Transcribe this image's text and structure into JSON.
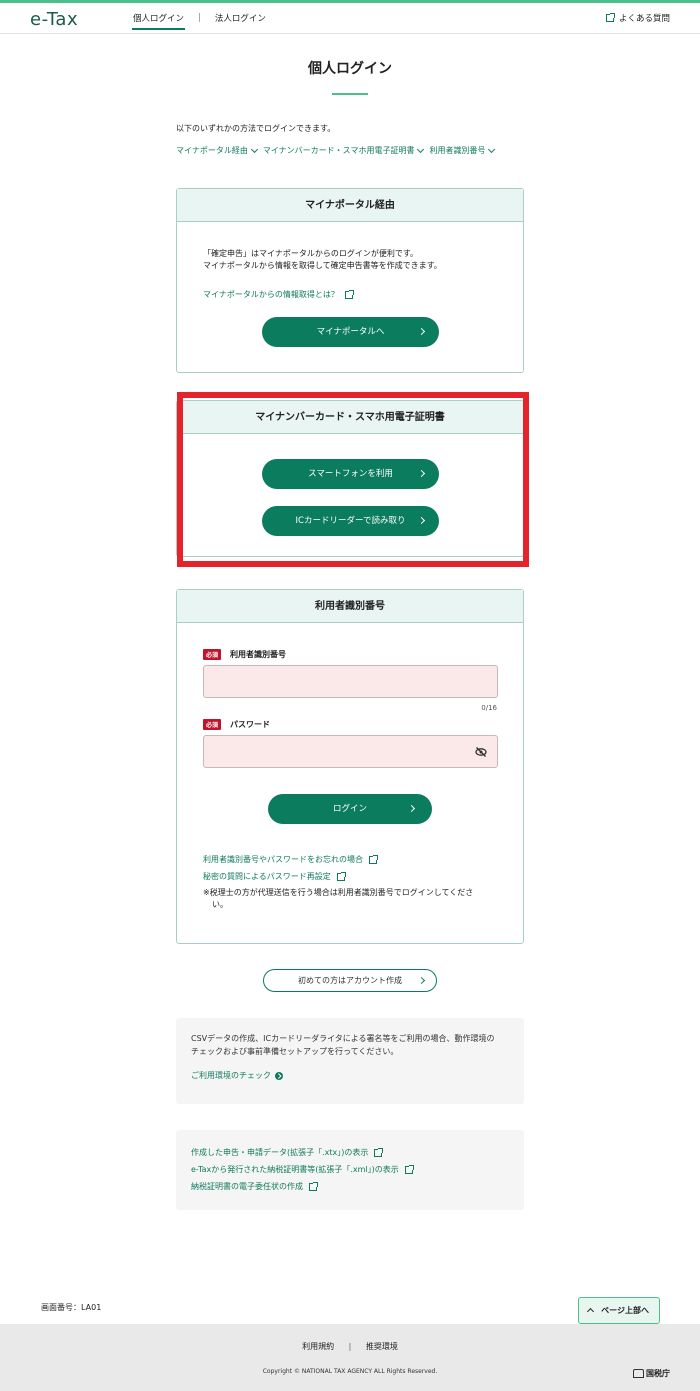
{
  "header": {
    "logo": "e-Tax",
    "tabs": [
      {
        "label": "個人ログイン"
      },
      {
        "label": "法人ログイン"
      }
    ],
    "separator": "|",
    "faq_label": "よくある質問"
  },
  "page": {
    "title": "個人ログイン",
    "intro": "以下のいずれかの方法でログインできます。",
    "anchors": [
      "マイナポータル経由",
      "マイナンバーカード・スマホ用電子証明書",
      "利用者識別番号"
    ]
  },
  "myna_portal": {
    "heading": "マイナポータル経由",
    "text1": "「確定申告」はマイナポータルからのログインが便利です。",
    "text2": "マイナポータルから情報を取得して確定申告書等を作成できます。",
    "link": "マイナポータルからの情報取得とは？",
    "button": "マイナポータルへ"
  },
  "mynumber_card": {
    "heading": "マイナンバーカード・スマホ用電子証明書",
    "button_smartphone": "スマートフォンを利用",
    "button_ic_reader": "ICカードリーダーで読み取り"
  },
  "user_id": {
    "heading": "利用者識別番号",
    "required_badge": "必須",
    "id_label": "利用者識別番号",
    "id_value": "",
    "id_count": "0/16",
    "password_label": "パスワード",
    "password_value": "",
    "login_button": "ログイン",
    "link_forgot": "利用者識別番号やパスワードをお忘れの場合",
    "link_reset": "秘密の質問によるパスワード再設定",
    "note_line1": "※税理士の方が代理送信を行う場合は利用者識別番号でログインしてくださ",
    "note_line2": "い。"
  },
  "create_account": "初めての方はアカウント作成",
  "env_box": {
    "text1": "CSVデータの作成、ICカードリーダライタによる署名等をご利用の場合、動作環境の",
    "text2": "チェックおよび事前準備セットアップを行ってください。",
    "link": "ご利用環境のチェック"
  },
  "file_links": [
    "作成した申告・申請データ(拡張子「.xtx」)の表示",
    "e-Taxから発行された納税証明書等(拡張子「.xml」)の表示",
    "納税証明書の電子委任状の作成"
  ],
  "screen_number": "画面番号：LA01",
  "page_top": "ページ上部へ",
  "footer": {
    "terms": "利用規約",
    "separator": "|",
    "recommended": "推奨環境",
    "copyright": "Copyright © NATIONAL TAX AGENCY ALL Rights Reserved.",
    "agency": "国税庁"
  }
}
